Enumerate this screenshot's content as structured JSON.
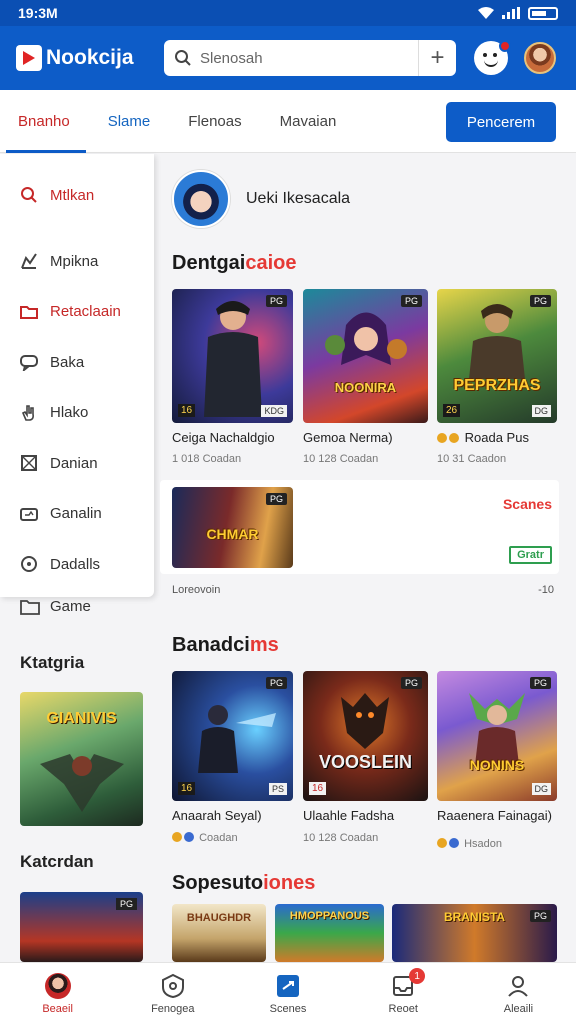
{
  "status_bar": {
    "time": "19:3M"
  },
  "app_bar": {
    "app_name": "Nookcija",
    "search_placeholder": "Slenosah"
  },
  "tabs": [
    {
      "label": "Bnanho"
    },
    {
      "label": "Slame"
    },
    {
      "label": "Flenoas"
    },
    {
      "label": "Mavaian"
    }
  ],
  "cta_label": "Pencerem",
  "drawer": {
    "items": [
      {
        "label": "Mtlkan",
        "icon": "search-icon"
      },
      {
        "label": "Mpikna",
        "icon": "chart-icon"
      },
      {
        "label": "Retaclaain",
        "icon": "folder-icon"
      },
      {
        "label": "Baka",
        "icon": "chat-icon"
      },
      {
        "label": "Hlako",
        "icon": "hand-icon"
      },
      {
        "label": "Danian",
        "icon": "bookmark-icon"
      },
      {
        "label": "Ganalin",
        "icon": "gamepad-icon"
      },
      {
        "label": "Dadalls",
        "icon": "info-icon"
      }
    ]
  },
  "left_column": {
    "game_label": "Game",
    "section1": "Ktatgria",
    "section1_card_title": "GIANIVIS",
    "section2": "Katcrdan"
  },
  "profile": {
    "name": "Ueki Ikesacala"
  },
  "section_featured": {
    "title_main": "Dentgai",
    "title_accent": "caioe"
  },
  "featured_games": [
    {
      "title": "Ceiga Nachaldgio",
      "meta": "1 018 Coadan",
      "badge": "PG",
      "corner_left": "16",
      "corner_right": "KDG"
    },
    {
      "title": "Gemoa Nerma)",
      "meta": "10 128 Coadan",
      "badge": "PG",
      "art_title": "NOONIRA"
    },
    {
      "title": "Roada Pus",
      "meta": "10 31 Caadon",
      "badge": "PG",
      "art_title": "PEPRZHAS",
      "corner_left": "26",
      "corner_right": "DG"
    }
  ],
  "scene_card": {
    "art_title": "CHMAR",
    "scenes_label": "Scanes",
    "free_tag": "Gratr"
  },
  "more_row": {
    "left": "Loreovoin",
    "right": "-10"
  },
  "section_second": {
    "title_main": "Banadci",
    "title_accent": "ms"
  },
  "second_games": [
    {
      "title": "Anaarah Seyal)",
      "meta": "Coadan",
      "badge": "PG",
      "corner_left": "16",
      "corner_right": "PS"
    },
    {
      "title": "Ulaahle Fadsha",
      "meta": "10 128 Coadan",
      "badge": "PG",
      "art_title": "VOOSLEIN",
      "corner_left": "16"
    },
    {
      "title": "Raaenera Fainagai)",
      "meta": "Hsadon",
      "badge": "PG",
      "art_title": "NONINS",
      "corner_right": "DG"
    }
  ],
  "section_third": {
    "title_main": "Sopesuto",
    "title_accent": "iones"
  },
  "third_games": [
    {
      "art_title": "BHAUGHDR"
    },
    {
      "art_title": "HMOPPANOUS"
    },
    {
      "art_title": "BRANISTA"
    }
  ],
  "bottom_nav": [
    {
      "label": "Beaeil",
      "icon": "avatar-icon",
      "active": true
    },
    {
      "label": "Fenogea",
      "icon": "shield-icon"
    },
    {
      "label": "Scenes",
      "icon": "tag-icon"
    },
    {
      "label": "Reoet",
      "icon": "inbox-icon",
      "badge": "1"
    },
    {
      "label": "Aleaili",
      "icon": "person-icon"
    }
  ]
}
